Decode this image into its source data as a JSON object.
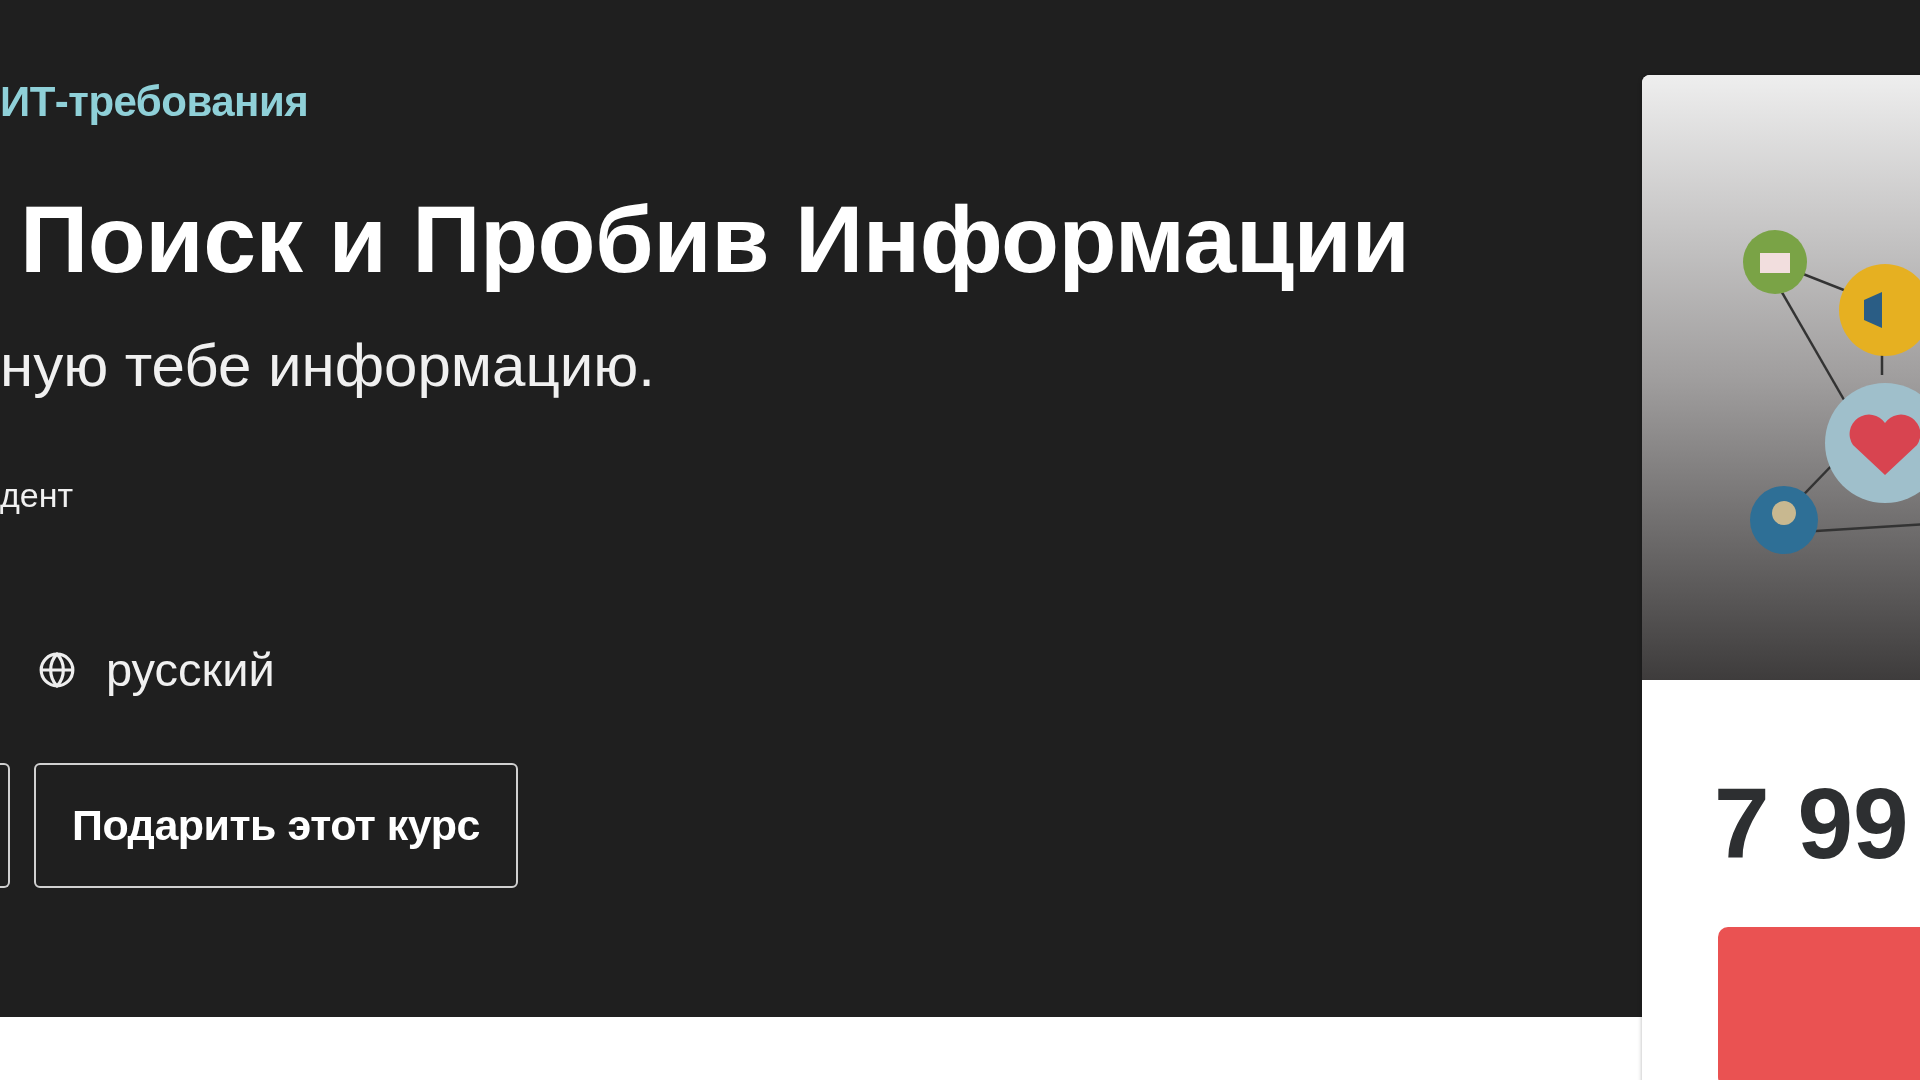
{
  "breadcrumb": "ИТ-требования",
  "title": "Поиск и Пробив Информации",
  "subtitle": "ную тебе информацию.",
  "meta": "дент",
  "language": "русский",
  "buttons": [
    {
      "kind": "partial"
    },
    {
      "kind": "outline",
      "label": "Подарить этот курс"
    }
  ],
  "sidebar": {
    "price": "7 99",
    "buy_button": {
      "kind": "primary"
    }
  }
}
